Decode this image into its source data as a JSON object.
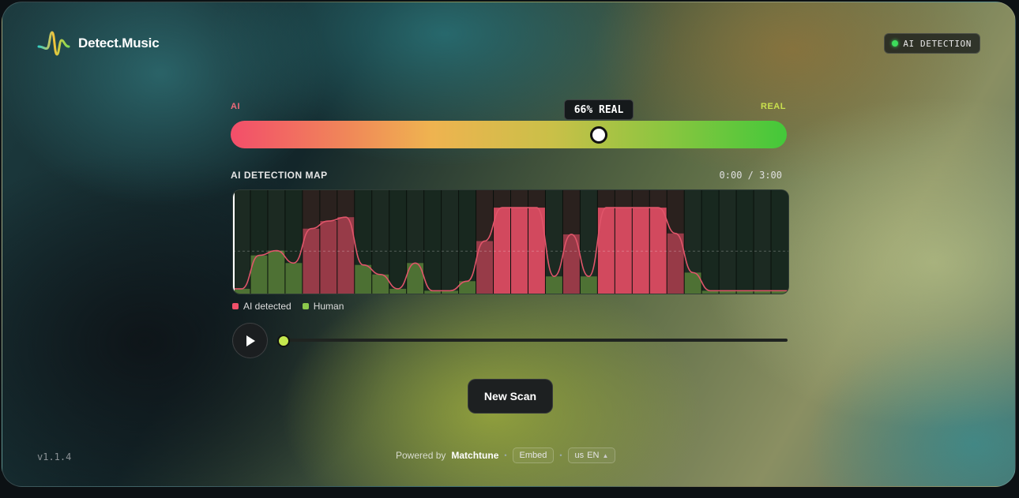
{
  "app": {
    "name": "Detect.Music",
    "version": "v1.1.4"
  },
  "status_badge": {
    "label": "AI DETECTION",
    "color": "#3ddc5c"
  },
  "meter": {
    "left_label": "AI",
    "right_label": "REAL",
    "value_label": "66% REAL",
    "value": 0.66
  },
  "map": {
    "title": "AI DETECTION MAP",
    "time": "0:00 / 3:00",
    "legend": [
      {
        "label": "AI detected",
        "color": "#f0506a"
      },
      {
        "label": "Human",
        "color": "#8cc84b"
      }
    ],
    "segments": [
      0.05,
      0.4,
      0.45,
      0.32,
      0.68,
      0.76,
      0.8,
      0.3,
      0.2,
      0.05,
      0.32,
      0.03,
      0.03,
      0.13,
      0.55,
      0.9,
      0.9,
      0.9,
      0.18,
      0.62,
      0.18,
      0.9,
      0.9,
      0.9,
      0.9,
      0.63,
      0.22,
      0.03,
      0.03,
      0.03,
      0.03,
      0.03
    ]
  },
  "player": {
    "play_icon": "play-icon",
    "progress": 0
  },
  "actions": {
    "new_scan": "New Scan"
  },
  "footer": {
    "powered_by": "Powered by",
    "brand": "Matchtune",
    "embed": "Embed",
    "flag": "us",
    "language": "EN"
  }
}
